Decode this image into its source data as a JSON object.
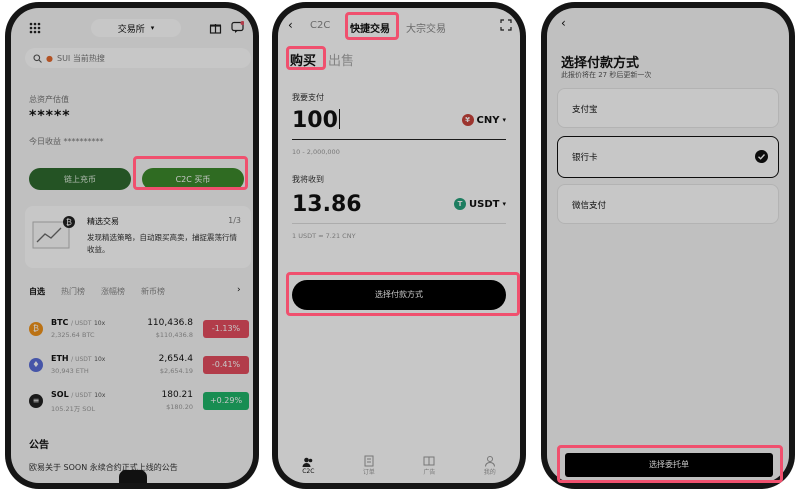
{
  "p1": {
    "header_title": "交易所",
    "search_placeholder": "SUI 当前热搜",
    "assets_label": "总资产估值",
    "assets_value": "*****",
    "today_label": "今日收益 **********",
    "btn_buy_onchain": "链上充币",
    "btn_c2c": "C2C 买币",
    "promo_title": "精选交易",
    "promo_page": "1/3",
    "promo_text": "发现精选策略，自动跟买高卖，捕捉震荡行情收益。",
    "tabs": [
      "自选",
      "热门榜",
      "涨幅榜",
      "新币榜"
    ],
    "rows": [
      {
        "sym": "BTC",
        "pair": "/ USDT",
        "lev": "10x",
        "sub": "2,325.64 BTC",
        "price": "110,436.8",
        "usd": "$110,436.8",
        "chg": "-1.13%",
        "up": false
      },
      {
        "sym": "ETH",
        "pair": "/ USDT",
        "lev": "10x",
        "sub": "30,943 ETH",
        "price": "2,654.4",
        "usd": "$2,654.19",
        "chg": "-0.41%",
        "up": false
      },
      {
        "sym": "SOL",
        "pair": "/ USDT",
        "lev": "10x",
        "sub": "105.21万 SOL",
        "price": "180.21",
        "usd": "$180.20",
        "chg": "+0.29%",
        "up": true
      }
    ],
    "notice_title": "公告",
    "notice_text": "欧易关于 SOON 永续合约正式上线的公告"
  },
  "p2": {
    "tab_c2c": "C2C",
    "tab_quick": "快捷交易",
    "tab_block": "大宗交易",
    "buy": "购买",
    "sell": "出售",
    "pay_label": "我要支付",
    "pay_amount": "100",
    "pay_ccy": "CNY",
    "pay_range": "10 - 2,000,000",
    "recv_label": "我将收到",
    "recv_amount": "13.86",
    "recv_ccy": "USDT",
    "rate": "1 USDT ≈ 7.21 CNY",
    "btn_select": "选择付款方式",
    "nav": [
      "C2C",
      "订单",
      "广告",
      "我的"
    ]
  },
  "p3": {
    "title": "选择付款方式",
    "sub": "此报价将在 27 秒后更新一次",
    "options": [
      "支付宝",
      "银行卡",
      "微信支付"
    ],
    "btn_order": "选择委托单"
  },
  "colors": {
    "highlight": "#f0506e",
    "green": "#2f8b2f",
    "red": "#e54d5f"
  }
}
